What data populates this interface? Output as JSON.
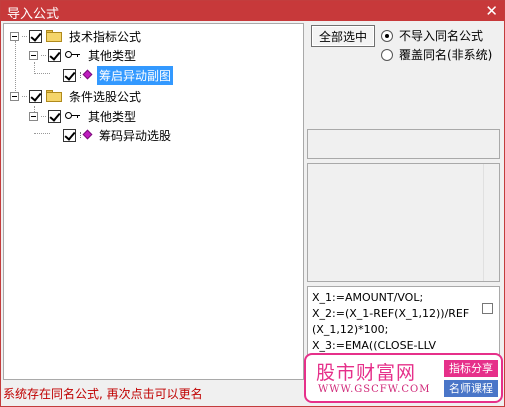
{
  "window": {
    "title": "导入公式",
    "close_glyph": "✕"
  },
  "tree": {
    "nodes": [
      {
        "label": "技术指标公式",
        "icon": "folder-icon",
        "checked": true
      },
      {
        "label": "其他类型",
        "icon": "key-icon",
        "checked": true
      },
      {
        "label": "筹启异动副图",
        "icon": "formula-icon",
        "checked": true,
        "selected": true
      },
      {
        "label": "条件选股公式",
        "icon": "folder-icon",
        "checked": true
      },
      {
        "label": "其他类型",
        "icon": "key-icon",
        "checked": true
      },
      {
        "label": "筹码异动选股",
        "icon": "formula-icon",
        "checked": true
      }
    ]
  },
  "options": {
    "select_all_label": "全部选中",
    "radio_no_import": "不导入同名公式",
    "radio_overwrite": "覆盖同名(非系统)",
    "selected_radio": "no_import"
  },
  "code": {
    "lines": [
      "X_1:=AMOUNT/VOL;",
      "X_2:=(X_1-REF(X_1,12))/REF",
      "(X_1,12)*100;",
      "X_3:=EMA((CLOSE-LLV"
    ]
  },
  "status": {
    "message": "系统存在同名公式, 再次点击可以更名"
  },
  "watermark": {
    "brand": "股市财富网",
    "url": "WWW.GSCFW.COM",
    "tag1": "指标分享",
    "tag2": "名师课程"
  },
  "colors": {
    "title_bar": "#c7393a",
    "selection": "#3399ff",
    "status_text": "#c00000",
    "watermark_pink": "#e6308a",
    "watermark_blue": "#4a76c8"
  }
}
